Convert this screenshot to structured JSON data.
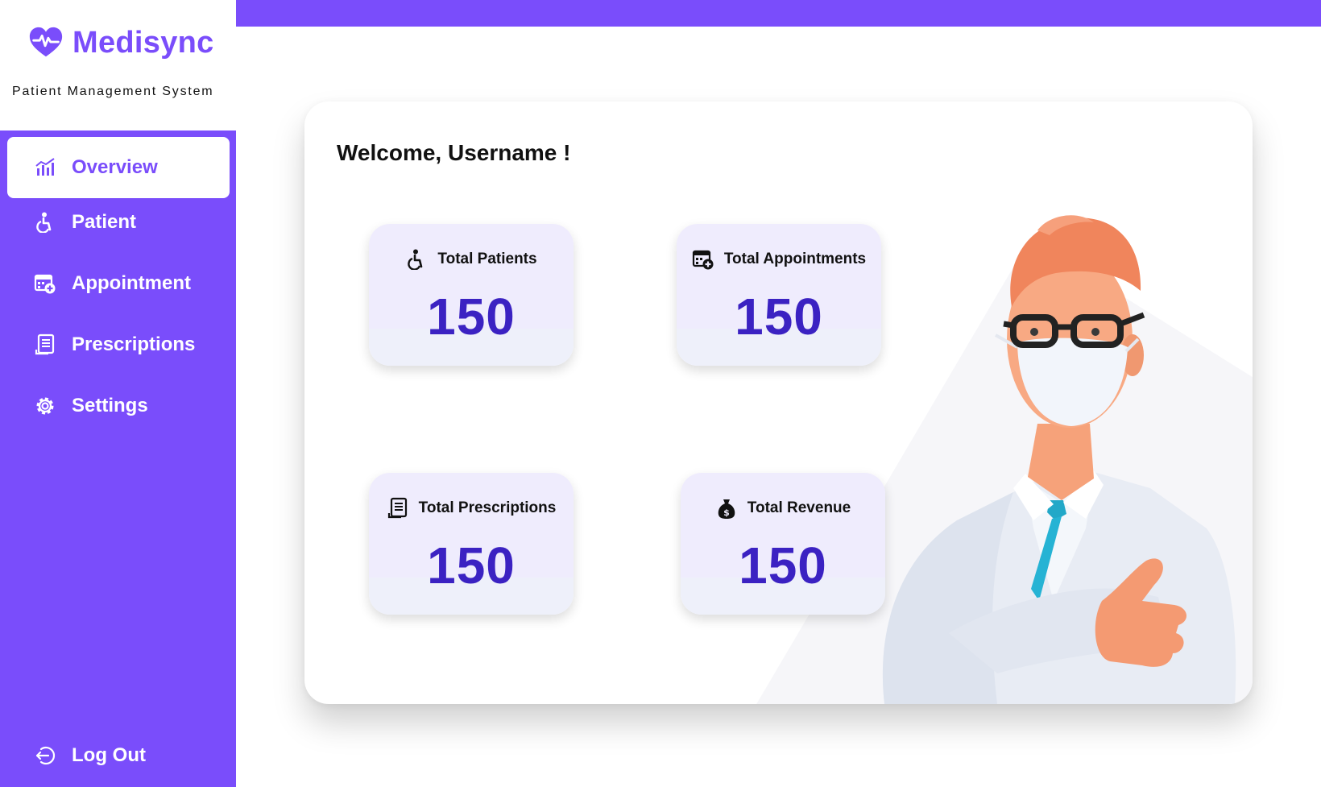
{
  "app": {
    "name": "Medisync",
    "tagline": "Patient Management System",
    "brand_color": "#7a4dfb"
  },
  "sidebar": {
    "items": [
      {
        "label": "Overview",
        "icon": "chart-icon",
        "active": true
      },
      {
        "label": "Patient",
        "icon": "person-icon",
        "active": false
      },
      {
        "label": "Appointment",
        "icon": "calendar-add-icon",
        "active": false
      },
      {
        "label": "Prescriptions",
        "icon": "receipt-icon",
        "active": false
      },
      {
        "label": "Settings",
        "icon": "gear-icon",
        "active": false
      }
    ],
    "logout_label": "Log Out"
  },
  "main": {
    "welcome": "Welcome, Username !",
    "stats": [
      {
        "label": "Total Patients",
        "value": "150",
        "icon": "person-icon"
      },
      {
        "label": "Total Appointments",
        "value": "150",
        "icon": "calendar-add-icon"
      },
      {
        "label": "Total Prescriptions",
        "value": "150",
        "icon": "receipt-icon"
      },
      {
        "label": "Total Revenue",
        "value": "150",
        "icon": "money-bag-icon"
      }
    ],
    "value_color": "#3b22c2"
  }
}
